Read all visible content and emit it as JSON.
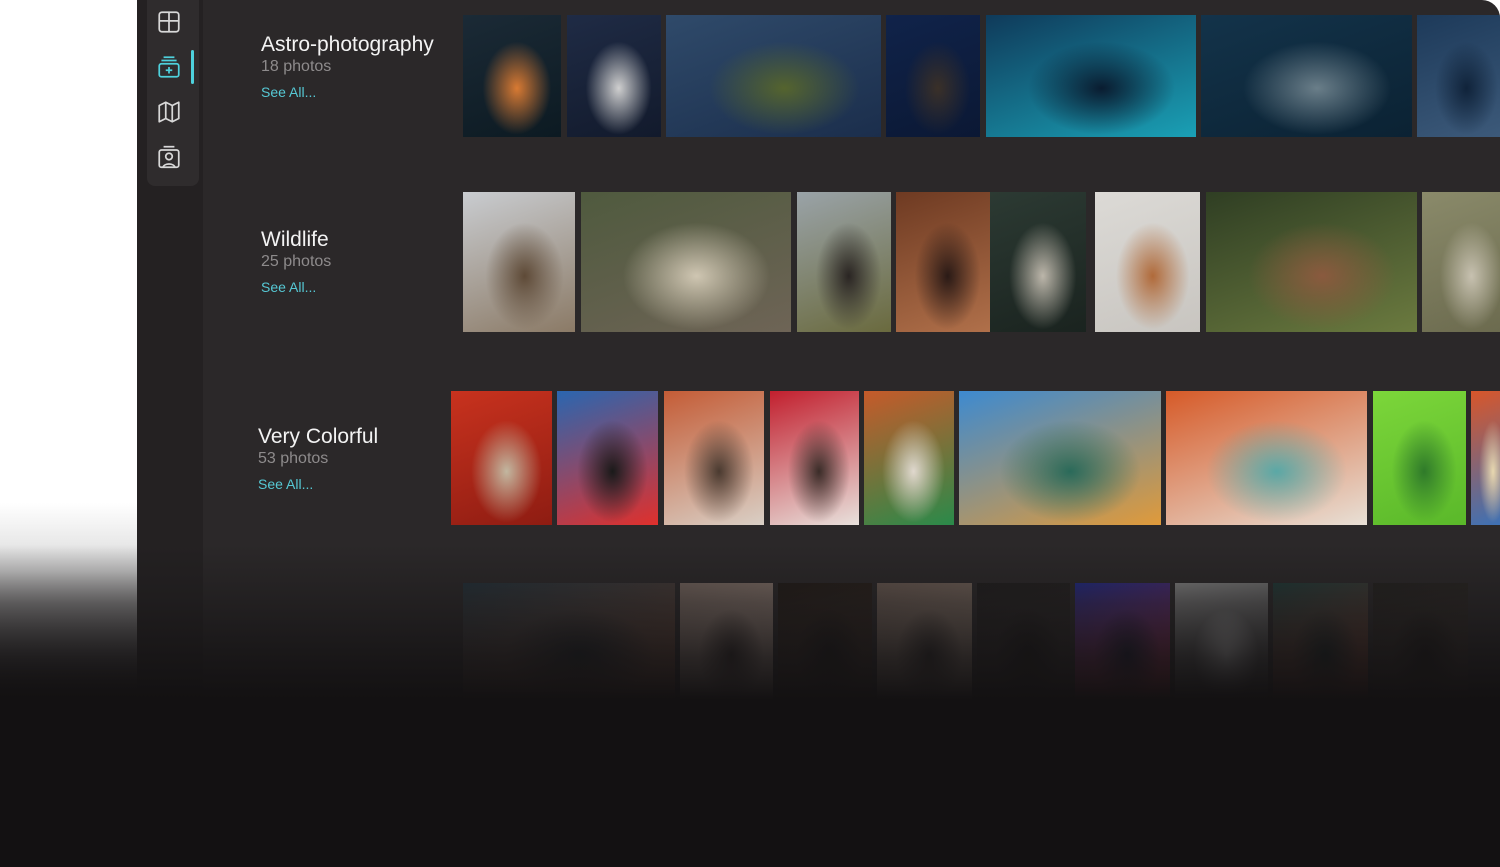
{
  "sidebar": {
    "items": [
      {
        "name": "grid-icon",
        "active": false
      },
      {
        "name": "add-album-icon",
        "active": true
      },
      {
        "name": "map-icon",
        "active": false
      },
      {
        "name": "people-icon",
        "active": false
      }
    ],
    "accent_color": "#4ed1dc"
  },
  "albums": [
    {
      "title": "Astro-photography",
      "count": "18 photos",
      "link": "See All...",
      "photos": [
        {
          "subject": "campfire under starry trees",
          "colors": [
            "#1b2a36",
            "#0c1a22",
            "#d87a33"
          ]
        },
        {
          "subject": "lighthouse under milky way",
          "colors": [
            "#1f2b45",
            "#121a2c",
            "#cfcfcf"
          ]
        },
        {
          "subject": "milky way over bay",
          "colors": [
            "#2f4a6a",
            "#1b2e4c",
            "#55642e"
          ]
        },
        {
          "subject": "night sky over hills",
          "colors": [
            "#10234a",
            "#0b1834",
            "#3a3028"
          ]
        },
        {
          "subject": "aurora over cabin",
          "colors": [
            "#0f3a5a",
            "#1aa0b5",
            "#0a1c30"
          ]
        },
        {
          "subject": "stars behind branches",
          "colors": [
            "#13334a",
            "#0b2233",
            "#6a7e89"
          ]
        },
        {
          "subject": "lake at dusk",
          "colors": [
            "#1d3a5a",
            "#3d5a7a",
            "#10233a"
          ]
        }
      ]
    },
    {
      "title": "Wildlife",
      "count": "25 photos",
      "link": "See All...",
      "photos": [
        {
          "subject": "bison in snow",
          "colors": [
            "#c9ccd0",
            "#8b7a66",
            "#5e4a37"
          ]
        },
        {
          "subject": "dog by fence",
          "colors": [
            "#4f5a3e",
            "#6e6456",
            "#cfc6b2"
          ]
        },
        {
          "subject": "cows grazing",
          "colors": [
            "#9aa3a8",
            "#6a6a3e",
            "#2a2523"
          ]
        },
        {
          "subject": "horse eye close-up",
          "colors": [
            "#6e3a22",
            "#b0704a",
            "#2a1a16"
          ]
        },
        {
          "subject": "cat in doorway",
          "colors": [
            "#2c3a33",
            "#1a231f",
            "#bcb6aa"
          ]
        },
        {
          "subject": "cat on paper",
          "colors": [
            "#dcdad6",
            "#c8c5c0",
            "#b06a3a"
          ]
        },
        {
          "subject": "dog in field",
          "colors": [
            "#2f3e23",
            "#6b7a3f",
            "#8a5a3e"
          ]
        },
        {
          "subject": "sheep on meadow",
          "colors": [
            "#8a8a6a",
            "#6b6a4e",
            "#c7c1b0"
          ]
        }
      ]
    },
    {
      "title": "Very Colorful",
      "count": "53 photos",
      "link": "See All...",
      "photos": [
        {
          "subject": "woman against red wall",
          "colors": [
            "#c8321e",
            "#8e1c12",
            "#c2b7a0"
          ]
        },
        {
          "subject": "heart graffiti shutter",
          "colors": [
            "#2a66b0",
            "#e0302c",
            "#1a1a1a"
          ]
        },
        {
          "subject": "totem on orange wall",
          "colors": [
            "#c45c36",
            "#d9cfc5",
            "#4a3a30"
          ]
        },
        {
          "subject": "red door with figure",
          "colors": [
            "#c21f2e",
            "#e8e1dc",
            "#3a2c28"
          ]
        },
        {
          "subject": "green window shutter",
          "colors": [
            "#c65a2a",
            "#2a8a4a",
            "#e0d8ce"
          ]
        },
        {
          "subject": "colorful houses by canal",
          "colors": [
            "#3d8ad0",
            "#e09a3a",
            "#2a6a5a"
          ]
        },
        {
          "subject": "orange house with bike",
          "colors": [
            "#d65a28",
            "#e8e0d6",
            "#5aa8a6"
          ]
        },
        {
          "subject": "lime green wall",
          "colors": [
            "#7cd63a",
            "#5ab82a",
            "#2f7a2a"
          ]
        },
        {
          "subject": "colorful facade",
          "colors": [
            "#d8562a",
            "#3a72b8",
            "#e8d8b0"
          ]
        }
      ]
    },
    {
      "title": "",
      "count": "",
      "link": "",
      "photos": [
        {
          "subject": "portrait in dark",
          "colors": [
            "#22313a",
            "#7a4a35",
            "#141c22"
          ]
        },
        {
          "subject": "hands over eyes",
          "colors": [
            "#7a6a62",
            "#b09a8e",
            "#2e2624"
          ]
        },
        {
          "subject": "dark portrait",
          "colors": [
            "#201a16",
            "#3a2a22",
            "#121010"
          ]
        },
        {
          "subject": "hand over face",
          "colors": [
            "#6a5a52",
            "#9a8878",
            "#2e2826"
          ]
        },
        {
          "subject": "dim figure",
          "colors": [
            "#1e1c1c",
            "#302a28",
            "#121010"
          ]
        },
        {
          "subject": "blue light portrait",
          "colors": [
            "#1f2a8a",
            "#c02a38",
            "#121430"
          ]
        },
        {
          "subject": "black and white portrait",
          "colors": [
            "#8a8a8a",
            "#3a3a3a",
            "#c8c8c8"
          ]
        },
        {
          "subject": "red-lit portrait",
          "colors": [
            "#1e3a38",
            "#8a3a2a",
            "#102020"
          ]
        },
        {
          "subject": "dark face",
          "colors": [
            "#22201e",
            "#3a302a",
            "#141210"
          ]
        }
      ]
    }
  ]
}
